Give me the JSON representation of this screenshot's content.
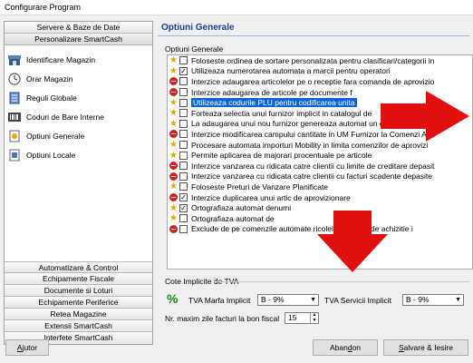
{
  "window": {
    "title": "Configurare Program"
  },
  "left": {
    "top_groups": [
      "Servere & Baze de Date",
      "Personalizare SmartCash"
    ],
    "nav_items": [
      {
        "label": "Identificare Magazin",
        "icon": "store-icon"
      },
      {
        "label": "Orar Magazin",
        "icon": "clock-icon"
      },
      {
        "label": "Reguli Globale",
        "icon": "rules-icon"
      },
      {
        "label": "Coduri de Bare Interne",
        "icon": "barcode-icon"
      },
      {
        "label": "Optiuni Generale",
        "icon": "settings-icon"
      },
      {
        "label": "Optiuni Locale",
        "icon": "local-settings-icon"
      }
    ],
    "bottom_groups": [
      "Automatizare & Control",
      "Echipamente Fiscale",
      "Documente si Loturi",
      "Echipamente Periferice",
      "Retea Magazine",
      "Extensii SmartCash",
      "Interfete SmartCash"
    ]
  },
  "main": {
    "title": "Optiuni Generale",
    "group_label": "Optiuni Generale",
    "options": [
      {
        "icon": "star",
        "checked": false,
        "text": "Foloseste ordinea de sortare personalizata pentru clasificari/categorii in"
      },
      {
        "icon": "star",
        "checked": true,
        "text": "Utilizeaza numerotarea automata a marcii pentru operatori"
      },
      {
        "icon": "stop",
        "checked": false,
        "text": "Interzice adaugarea articolelor pe o receptie fara comanda de aprovizio"
      },
      {
        "icon": "stop",
        "checked": false,
        "text": "Interzice adaugarea de articole pe documente f"
      },
      {
        "icon": "star",
        "checked": false,
        "text": "Utilizeaza codurile PLU pentru codificarea unita",
        "selected": true
      },
      {
        "icon": "star",
        "checked": false,
        "text": "Forteaza selectia unui furnizor implicit in catalogul de"
      },
      {
        "icon": "star",
        "checked": false,
        "text": "La adaugarea unui nou furnizor genereaza automat un cod de furnizor"
      },
      {
        "icon": "stop",
        "checked": false,
        "text": "Interzice modificarea campului cantitate in UM Furnizor la Comenzi Ap"
      },
      {
        "icon": "star",
        "checked": false,
        "text": "Procesare automata importuri Mobility in limita comenzilor de aprovizi"
      },
      {
        "icon": "star",
        "checked": false,
        "text": "Permite aplicarea de majorari procentuale pe articole"
      },
      {
        "icon": "stop",
        "checked": false,
        "text": "Interzice vanzarea cu ridicata catre clientii cu limite de creditare depasit"
      },
      {
        "icon": "stop",
        "checked": false,
        "text": "Interzice vanzarea cu ridicata catre clientii cu facturi scadente depasite"
      },
      {
        "icon": "star",
        "checked": false,
        "text": "Foloseste Preturi de Vanzare Planificate"
      },
      {
        "icon": "stop",
        "checked": true,
        "text": "Interzice duplicarea unui artic                 de aprovizionare"
      },
      {
        "icon": "star",
        "checked": true,
        "text": "Ortografiaza automat denumi"
      },
      {
        "icon": "star",
        "checked": false,
        "text": "Ortografiaza automat de"
      },
      {
        "icon": "stop",
        "checked": false,
        "text": "Exclude de pe comenzile automate                           ricolele fara pret de achizitie i"
      }
    ],
    "vat": {
      "label": "Cote Implicite de TVA",
      "marfa_label": "TVA Marfa Implicit",
      "marfa_value": "B - 9%",
      "servicii_label": "TVA Servicii Implicit",
      "servicii_value": "B - 9%",
      "days_label": "Nr. maxim zile facturi la bon fiscal",
      "days_value": "15"
    }
  },
  "buttons": {
    "help": {
      "pre": "",
      "ul": "A",
      "post": "jutor"
    },
    "cancel": {
      "pre": "Aban",
      "ul": "d",
      "post": "on"
    },
    "save": {
      "pre": "",
      "ul": "S",
      "post": "alvare & Iesire"
    }
  },
  "colors": {
    "accent": "#1c3f8f",
    "selection": "#0a64d8",
    "arrow": "#e01010"
  }
}
